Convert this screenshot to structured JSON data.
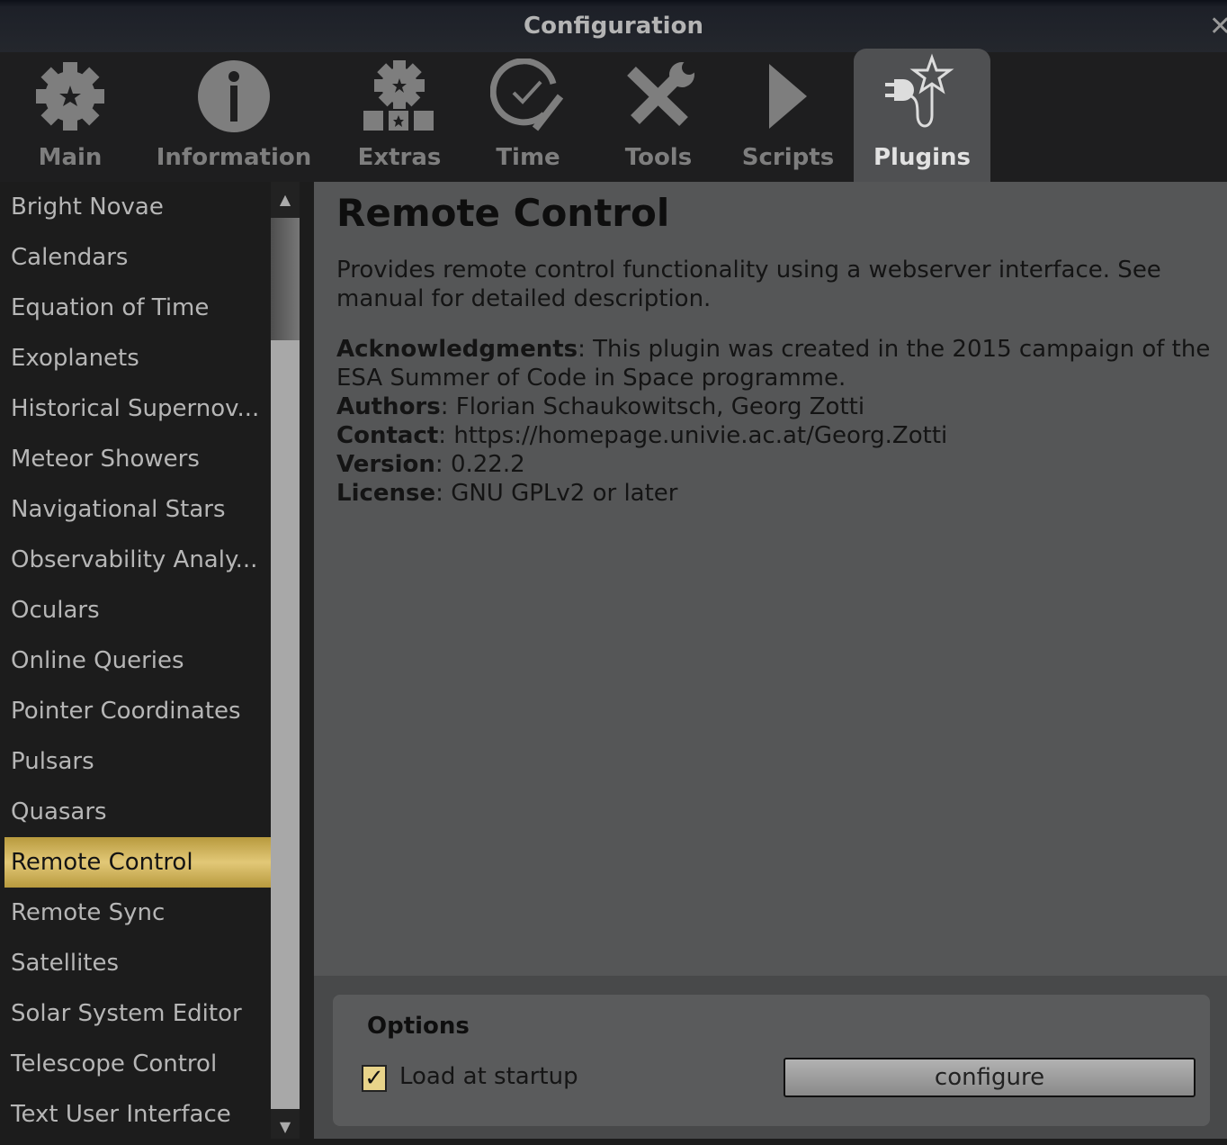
{
  "window": {
    "title": "Configuration",
    "close_icon": "close-icon"
  },
  "tabs": [
    {
      "label": "Main",
      "icon": "gear-star-icon"
    },
    {
      "label": "Information",
      "icon": "info-icon"
    },
    {
      "label": "Extras",
      "icon": "extras-gear-icon"
    },
    {
      "label": "Time",
      "icon": "clock-wrench-icon"
    },
    {
      "label": "Tools",
      "icon": "tools-icon"
    },
    {
      "label": "Scripts",
      "icon": "play-icon"
    },
    {
      "label": "Plugins",
      "icon": "plug-star-icon",
      "active": true
    }
  ],
  "plugins": [
    "Bright Novae",
    "Calendars",
    "Equation of Time",
    "Exoplanets",
    "Historical Supernov...",
    "Meteor Showers",
    "Navigational Stars",
    "Observability Analy...",
    "Oculars",
    "Online Queries",
    "Pointer Coordinates",
    "Pulsars",
    "Quasars",
    "Remote Control",
    "Remote Sync",
    "Satellites",
    "Solar System Editor",
    "Telescope Control",
    "Text User Interface"
  ],
  "selected_plugin": "Remote Control",
  "detail": {
    "title": "Remote Control",
    "description": "Provides remote control functionality using a webserver interface. See manual for detailed description.",
    "ack_label": "Acknowledgments",
    "ack": "This plugin was created in the 2015 campaign of the ESA Summer of Code in Space programme.",
    "authors_label": "Authors",
    "authors": "Florian Schaukowitsch, Georg Zotti",
    "contact_label": "Contact",
    "contact": "https://homepage.univie.ac.at/Georg.Zotti",
    "version_label": "Version",
    "version": "0.22.2",
    "license_label": "License",
    "license": "GNU GPLv2 or later"
  },
  "options": {
    "title": "Options",
    "load_at_startup_label": "Load at startup",
    "load_at_startup": true,
    "configure_label": "configure"
  },
  "colors": {
    "selected": "#d8bd68",
    "panel": "#555657",
    "sidebar": "#1c1c1c"
  }
}
